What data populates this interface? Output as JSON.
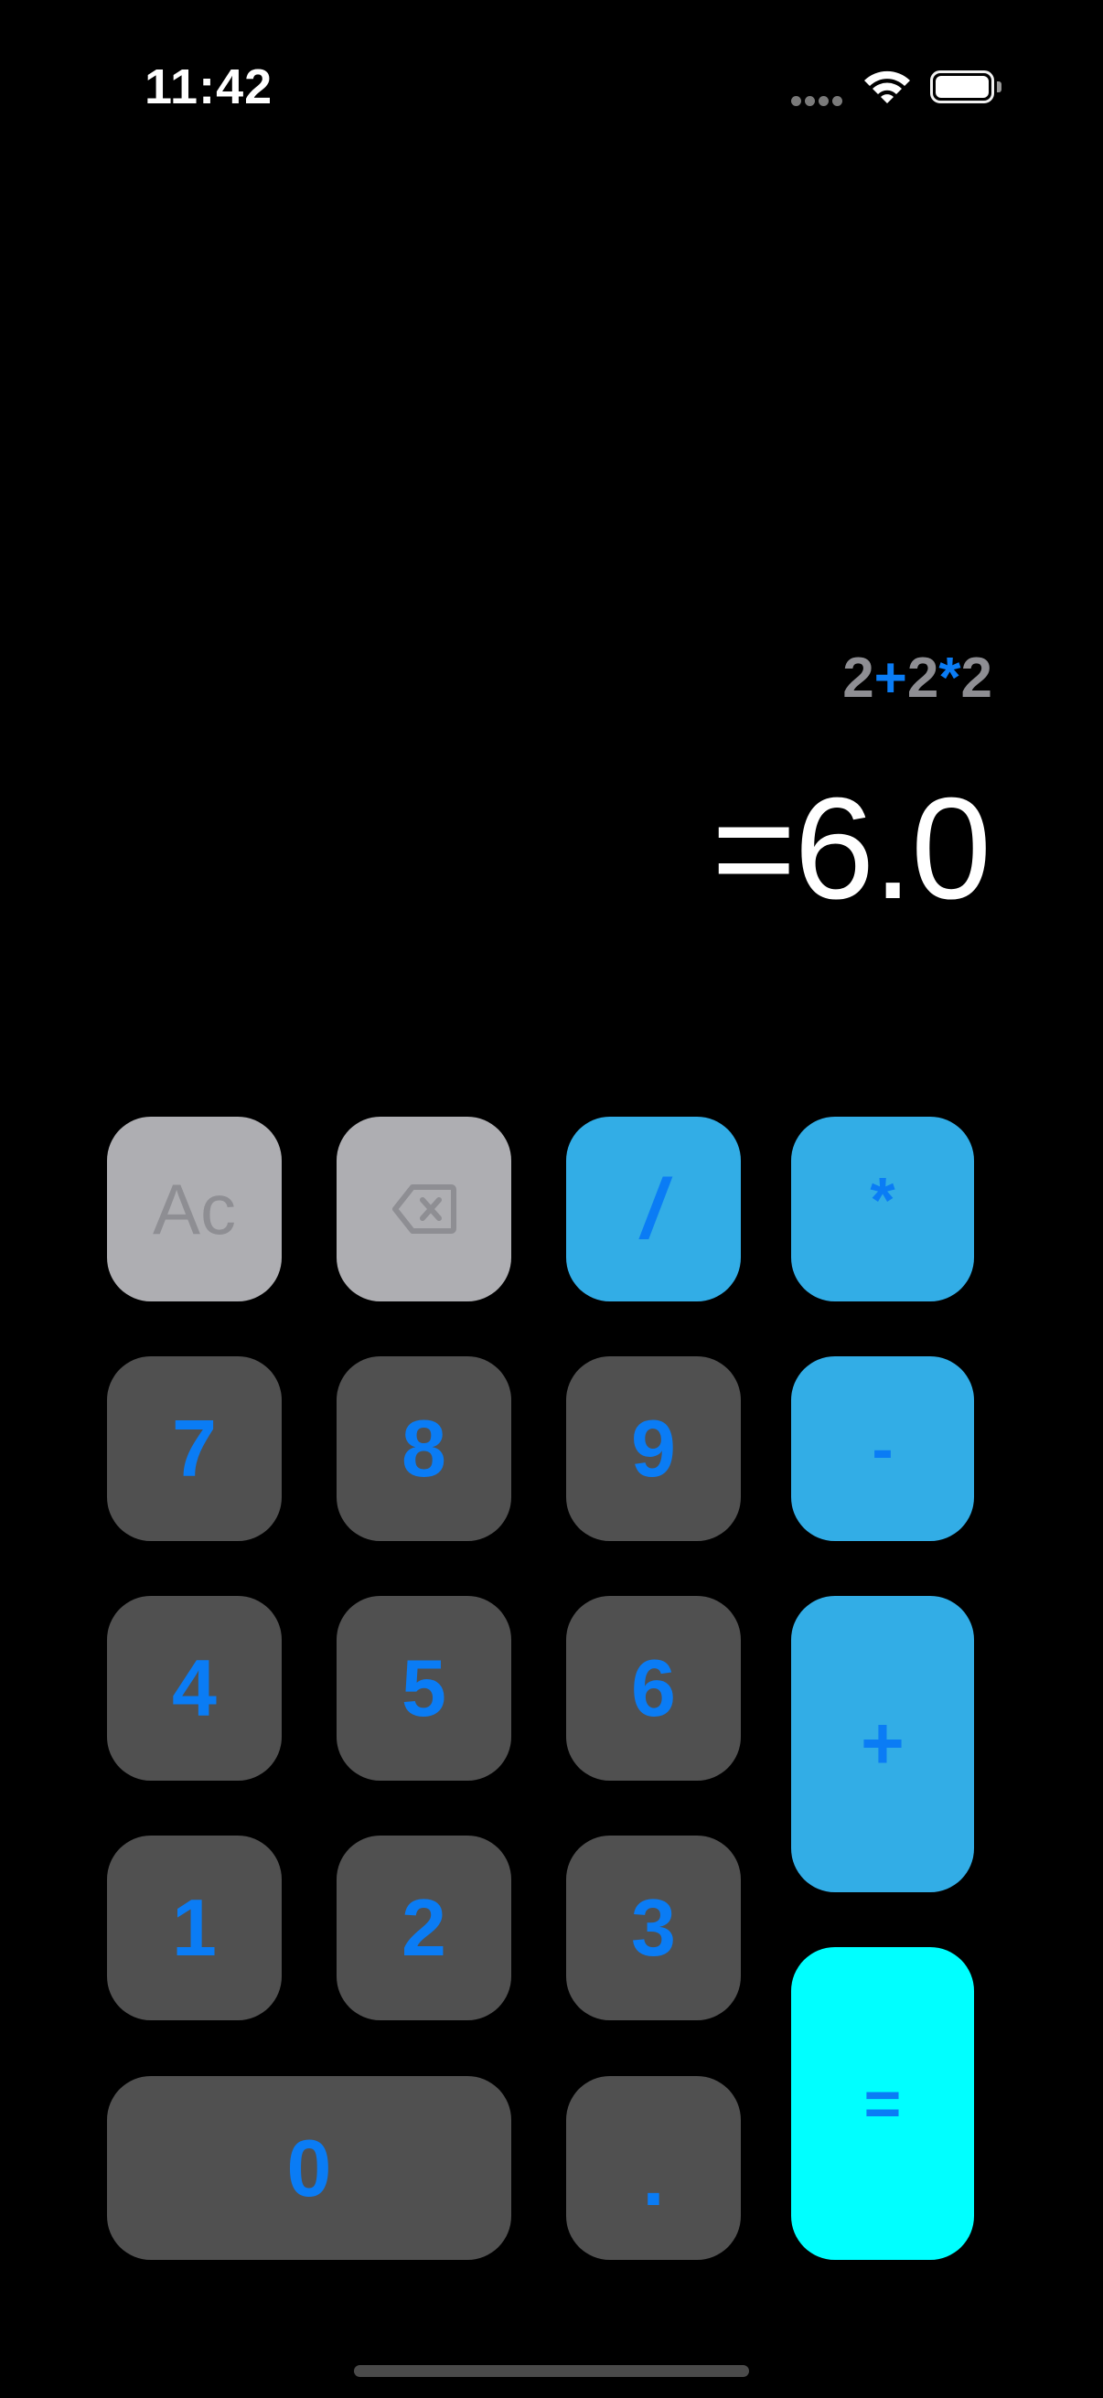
{
  "status_bar": {
    "time": "11:42",
    "signal_icon": "cellular-signal-icon",
    "wifi_icon": "wifi-icon",
    "battery_icon": "battery-full-icon",
    "battery_level": 1.0
  },
  "display": {
    "expression": {
      "operand1": "2",
      "operator1": "+",
      "operand2": "2",
      "operator2": "*",
      "operand3": "2"
    },
    "result": "=6.0"
  },
  "keypad": {
    "ac": "Ac",
    "backspace_icon": "backspace-icon",
    "divide": "/",
    "multiply": "*",
    "subtract": "-",
    "add": "+",
    "equals": "=",
    "decimal": ".",
    "digits": {
      "zero": "0",
      "one": "1",
      "two": "2",
      "three": "3",
      "four": "4",
      "five": "5",
      "six": "6",
      "seven": "7",
      "eight": "8",
      "nine": "9"
    }
  },
  "colors": {
    "background": "#000000",
    "number_key": "#505050",
    "function_key": "#aeaeb2",
    "operator_key": "#32ade6",
    "equals_key": "#00ffff",
    "key_text": "#0a7cf5",
    "expression_operand": "#8e8e93",
    "result_text": "#ffffff"
  }
}
